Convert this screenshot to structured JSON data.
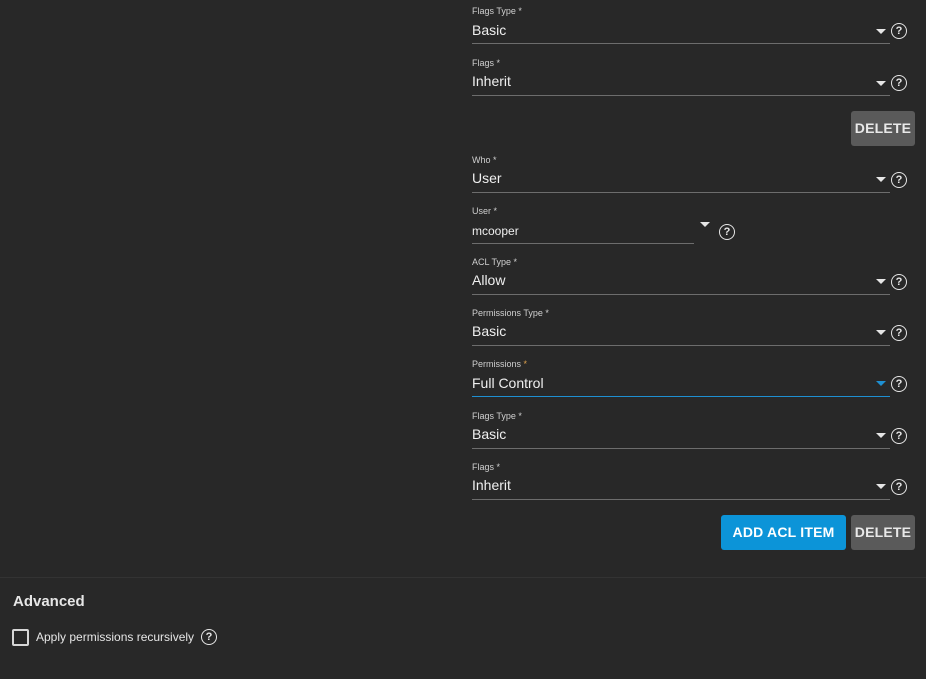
{
  "form": {
    "entries": [
      {
        "fields": [
          {
            "id": "flags-type-1",
            "label": "Flags Type",
            "value": "Basic"
          },
          {
            "id": "flags-1",
            "label": "Flags",
            "value": "Inherit"
          }
        ],
        "delete_label": "DELETE"
      },
      {
        "fields": [
          {
            "id": "who-2",
            "label": "Who",
            "value": "User"
          },
          {
            "id": "user-2",
            "label": "User",
            "value": "mcooper"
          },
          {
            "id": "acl-type-2",
            "label": "ACL Type",
            "value": "Allow"
          },
          {
            "id": "permissions-type-2",
            "label": "Permissions Type",
            "value": "Basic"
          },
          {
            "id": "permissions-2",
            "label": "Permissions",
            "value": "Full Control"
          },
          {
            "id": "flags-type-2",
            "label": "Flags Type",
            "value": "Basic"
          },
          {
            "id": "flags-2",
            "label": "Flags",
            "value": "Inherit"
          }
        ],
        "add_label": "ADD ACL ITEM",
        "delete_label": "DELETE"
      }
    ],
    "required_marker": "*",
    "help_glyph": "?"
  },
  "advanced": {
    "title": "Advanced",
    "recursive_label": "Apply permissions recursively",
    "recursive_checked": false
  },
  "colors": {
    "background": "#282828",
    "accent": "#0c94d8",
    "focus_underline": "#1e8fd1",
    "required_focused": "#e0a24d",
    "button_grey": "#5a5a5a"
  },
  "icons": {
    "dropdown": "caret-down-icon",
    "help": "help-circle-icon",
    "checkbox": "checkbox-unchecked-icon"
  }
}
